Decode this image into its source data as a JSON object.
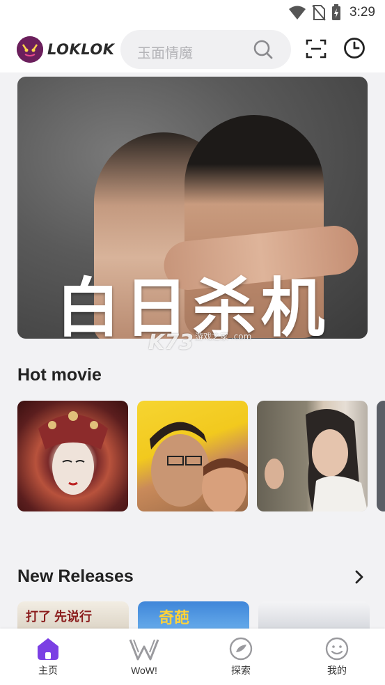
{
  "status_bar": {
    "time": "3:29",
    "icons": [
      "wifi-icon",
      "no-sim-icon",
      "battery-charging-icon"
    ]
  },
  "header": {
    "logo_text": "LOKLOK",
    "search": {
      "placeholder": "玉面情魔"
    },
    "icons": [
      "search-icon",
      "scan-icon",
      "history-icon"
    ]
  },
  "banner": {
    "title": "白日杀机"
  },
  "watermark": {
    "text": "K73",
    "sub": "游戏之家 .com"
  },
  "hot_movie": {
    "title": "Hot movie",
    "items": [
      {
        "id": "p1"
      },
      {
        "id": "p2"
      },
      {
        "id": "p3"
      },
      {
        "id": "p4"
      }
    ]
  },
  "new_releases": {
    "title": "New Releases",
    "more_icon": "chevron-right-icon",
    "items": [
      {
        "caption": "打了 先说行"
      },
      {
        "caption": "奇葩"
      },
      {
        "caption": ""
      }
    ]
  },
  "tabbar": {
    "active_color": "#7b3fe4",
    "tabs": [
      {
        "label": "主页",
        "icon": "home-icon"
      },
      {
        "label": "WoW!",
        "icon": "wow-icon"
      },
      {
        "label": "探索",
        "icon": "explore-icon"
      },
      {
        "label": "我的",
        "icon": "profile-icon"
      }
    ]
  }
}
